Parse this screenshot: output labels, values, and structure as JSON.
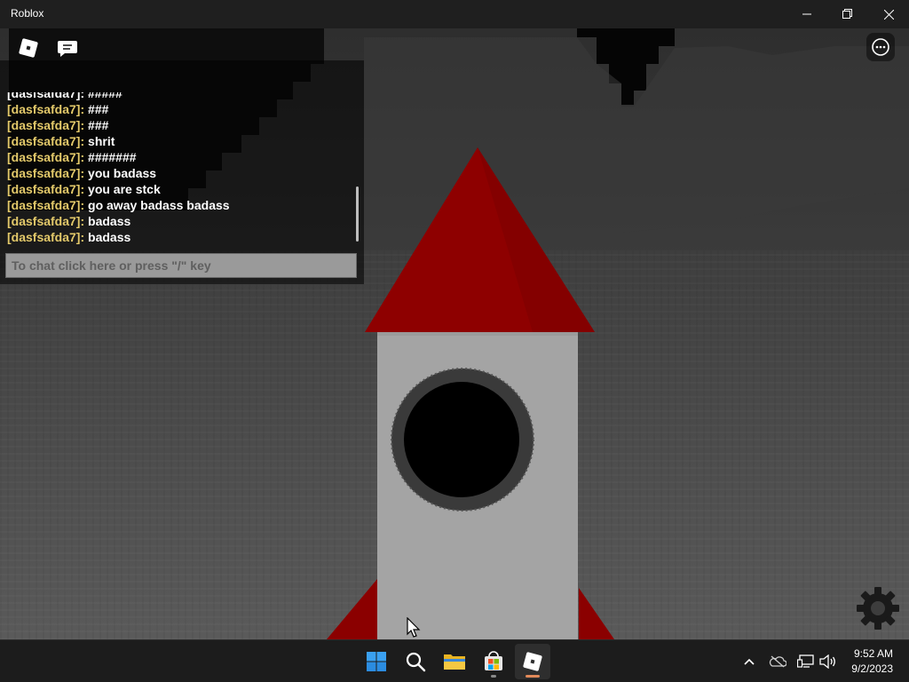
{
  "window": {
    "title": "Roblox",
    "controls": [
      "minimize",
      "restore",
      "close"
    ]
  },
  "topbar": {
    "icons": [
      "roblox-menu-icon",
      "chat-icon",
      "more-options-icon"
    ]
  },
  "chat": {
    "partial_top_line": "[dasfsafda7]: #####",
    "messages": [
      {
        "name": "[dasfsafda7]:",
        "text": "###"
      },
      {
        "name": "[dasfsafda7]:",
        "text": "###"
      },
      {
        "name": "[dasfsafda7]:",
        "text": "shrit"
      },
      {
        "name": "[dasfsafda7]:",
        "text": "#######"
      },
      {
        "name": "[dasfsafda7]:",
        "text": "you badass"
      },
      {
        "name": "[dasfsafda7]:",
        "text": "you are stck"
      },
      {
        "name": "[dasfsafda7]:",
        "text": "go away badass badass"
      },
      {
        "name": "[dasfsafda7]:",
        "text": "badass"
      },
      {
        "name": "[dasfsafda7]:",
        "text": "badass"
      }
    ],
    "input_placeholder": "To chat click here or press \"/\" key"
  },
  "scene": {
    "rocket_cone_color": "#8b0000",
    "rocket_body_color": "#a3a3a3",
    "porthole_color": "#000000"
  },
  "game_ui": {
    "settings_icon": "gear-icon"
  },
  "taskbar": {
    "apps": [
      "windows-start-icon",
      "search-icon",
      "file-explorer-icon",
      "microsoft-store-icon",
      "roblox-app-icon"
    ],
    "tray": [
      "chevron-up-icon",
      "onedrive-icon",
      "network-icon",
      "volume-icon"
    ],
    "time": "9:52 AM",
    "date": "9/2/2023"
  },
  "colors": {
    "username": "#e3c96a",
    "accent_active": "#e38a5a"
  }
}
